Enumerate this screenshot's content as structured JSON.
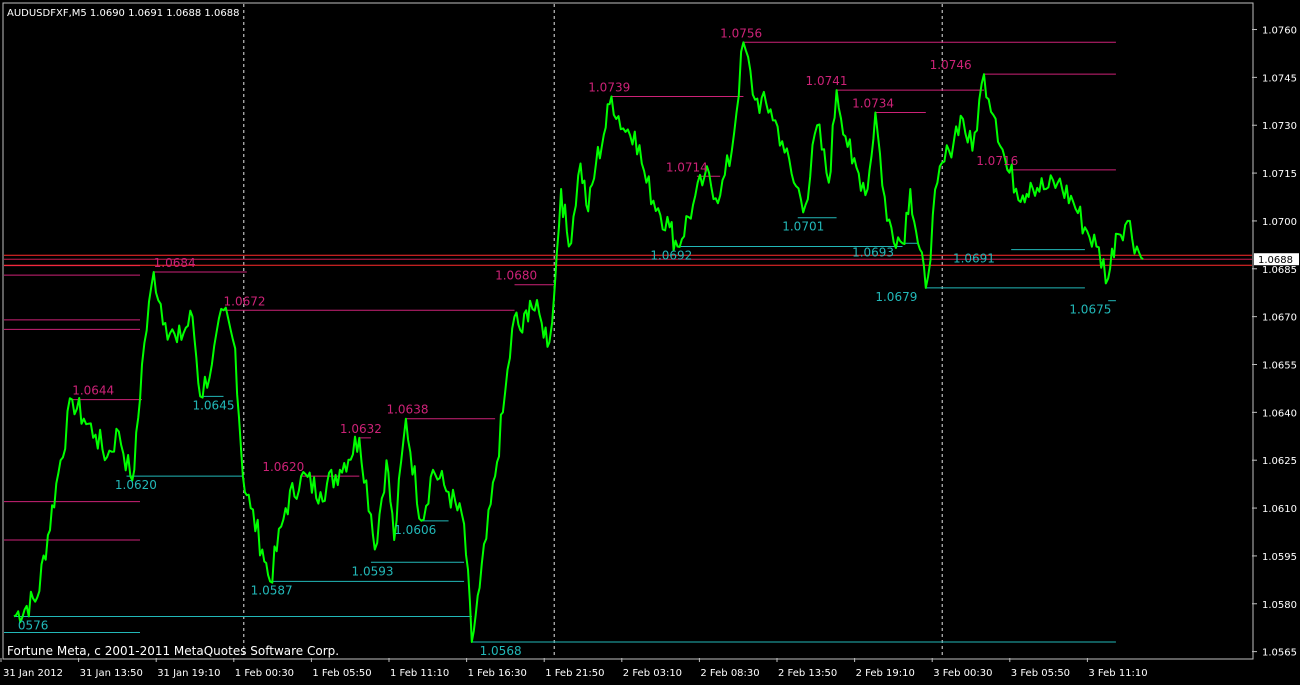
{
  "header": {
    "symbol_line": "AUDUSDFXF,M5  1.0690 1.0691 1.0688 1.0688"
  },
  "footer": {
    "copyright": "Fortune Meta, c 2001-2011 MetaQuotes Software Corp."
  },
  "colors": {
    "background": "#000000",
    "frame": "#c0c0c0",
    "price_line": "#00ff00",
    "resistance": "#cc2277",
    "support": "#22b8b8",
    "current_price_line": "#ff0000",
    "separator": "#ffffff"
  },
  "chart_data": {
    "type": "line",
    "symbol": "AUDUSDFXF",
    "timeframe": "M5",
    "ylim": [
      1.0563,
      1.0768
    ],
    "current_price": "1.0688",
    "y_ticks": [
      "1.0760",
      "1.0745",
      "1.0730",
      "1.0715",
      "1.0700",
      "1.0685",
      "1.0670",
      "1.0655",
      "1.0640",
      "1.0625",
      "1.0610",
      "1.0595",
      "1.0580",
      "1.0565"
    ],
    "x_ticks": [
      "31 Jan 2012",
      "31 Jan 13:50",
      "31 Jan 19:10",
      "1 Feb 00:30",
      "1 Feb 05:50",
      "1 Feb 11:10",
      "1 Feb 16:30",
      "1 Feb 21:50",
      "2 Feb 03:10",
      "2 Feb 08:30",
      "2 Feb 13:50",
      "2 Feb 19:10",
      "3 Feb 00:30",
      "3 Feb 05:50",
      "3 Feb 11:10"
    ],
    "day_separators_at_tick": [
      3,
      7,
      12
    ],
    "series": [
      {
        "values": [
          [
            0,
            1.0576
          ],
          [
            0.3,
            1.0582
          ],
          [
            0.6,
            1.0625
          ],
          [
            0.75,
            1.0644
          ],
          [
            0.9,
            1.0638
          ],
          [
            1.05,
            1.0633
          ],
          [
            1.2,
            1.0626
          ],
          [
            1.35,
            1.0634
          ],
          [
            1.5,
            1.062
          ],
          [
            1.55,
            1.0622
          ],
          [
            1.65,
            1.0655
          ],
          [
            1.8,
            1.0684
          ],
          [
            1.95,
            1.0668
          ],
          [
            2.1,
            1.0662
          ],
          [
            2.3,
            1.067
          ],
          [
            2.4,
            1.0645
          ],
          [
            2.55,
            1.0655
          ],
          [
            2.7,
            1.0672
          ],
          [
            2.85,
            1.066
          ],
          [
            2.95,
            1.062
          ],
          [
            3.05,
            1.061
          ],
          [
            3.2,
            1.0597
          ],
          [
            3.3,
            1.0587
          ],
          [
            3.5,
            1.061
          ],
          [
            3.7,
            1.062
          ],
          [
            3.95,
            1.0615
          ],
          [
            4.2,
            1.0622
          ],
          [
            4.45,
            1.0632
          ],
          [
            4.6,
            1.0608
          ],
          [
            4.65,
            1.0597
          ],
          [
            4.8,
            1.0625
          ],
          [
            4.9,
            1.06
          ],
          [
            5.05,
            1.0638
          ],
          [
            5.25,
            1.0606
          ],
          [
            5.4,
            1.0622
          ],
          [
            5.6,
            1.0615
          ],
          [
            5.8,
            1.0605
          ],
          [
            5.9,
            1.0568
          ],
          [
            6.0,
            1.0585
          ],
          [
            6.2,
            1.062
          ],
          [
            6.3,
            1.064
          ],
          [
            6.45,
            1.067
          ],
          [
            6.55,
            1.0665
          ],
          [
            6.65,
            1.0675
          ],
          [
            6.8,
            1.0668
          ],
          [
            6.9,
            1.0662
          ],
          [
            6.97,
            1.068
          ],
          [
            7.05,
            1.071
          ],
          [
            7.15,
            1.0692
          ],
          [
            7.3,
            1.0718
          ],
          [
            7.4,
            1.0703
          ],
          [
            7.5,
            1.0718
          ],
          [
            7.6,
            1.0727
          ],
          [
            7.7,
            1.0739
          ],
          [
            7.85,
            1.0729
          ],
          [
            8.0,
            1.0728
          ],
          [
            8.15,
            1.0712
          ],
          [
            8.3,
            1.0704
          ],
          [
            8.45,
            1.0698
          ],
          [
            8.55,
            1.0692
          ],
          [
            8.75,
            1.0705
          ],
          [
            8.9,
            1.0714
          ],
          [
            9.1,
            1.0708
          ],
          [
            9.25,
            1.0722
          ],
          [
            9.4,
            1.0756
          ],
          [
            9.55,
            1.0738
          ],
          [
            9.75,
            1.0735
          ],
          [
            9.9,
            1.0725
          ],
          [
            10.05,
            1.0712
          ],
          [
            10.2,
            1.0705
          ],
          [
            10.35,
            1.073
          ],
          [
            10.5,
            1.0712
          ],
          [
            10.6,
            1.0741
          ],
          [
            10.8,
            1.0718
          ],
          [
            11.0,
            1.071
          ],
          [
            11.1,
            1.0734
          ],
          [
            11.25,
            1.07
          ],
          [
            11.45,
            1.0693
          ],
          [
            11.55,
            1.071
          ],
          [
            11.65,
            1.0693
          ],
          [
            11.75,
            1.0679
          ],
          [
            11.9,
            1.0712
          ],
          [
            12.05,
            1.0722
          ],
          [
            12.2,
            1.0733
          ],
          [
            12.35,
            1.0722
          ],
          [
            12.5,
            1.0746
          ],
          [
            12.65,
            1.0732
          ],
          [
            12.8,
            1.0716
          ],
          [
            13.0,
            1.0708
          ],
          [
            13.1,
            1.0712
          ],
          [
            13.3,
            1.071
          ],
          [
            13.45,
            1.0712
          ],
          [
            13.65,
            1.0706
          ],
          [
            13.8,
            1.0698
          ],
          [
            13.95,
            1.0692
          ],
          [
            14.1,
            1.0682
          ],
          [
            14.2,
            1.0696
          ],
          [
            14.35,
            1.07
          ],
          [
            14.5,
            1.069
          ],
          [
            14.55,
            1.0688
          ]
        ]
      }
    ],
    "resistance_levels": [
      {
        "label": "1.0644",
        "x_from": 0.75,
        "x_to": 1.65
      },
      {
        "label": "1.0684",
        "x_from": 1.8,
        "x_to": 3.0
      },
      {
        "label": "1.0672",
        "x_from": 2.7,
        "x_to": 6.45
      },
      {
        "label": "1.0620",
        "x_from": 3.7,
        "x_to": 4.45
      },
      {
        "label": "1.0632",
        "x_from": 4.45,
        "x_to": 4.6
      },
      {
        "label": "1.0638",
        "x_from": 5.05,
        "x_to": 6.2
      },
      {
        "label": "1.0680",
        "x_from": 6.45,
        "x_to": 6.97
      },
      {
        "label": "1.0739",
        "x_from": 7.7,
        "x_to": 9.4
      },
      {
        "label": "1.0714",
        "x_from": 8.8,
        "x_to": 9.1
      },
      {
        "label": "1.0756",
        "x_from": 9.4,
        "x_to": 14.2
      },
      {
        "label": "1.0741",
        "x_from": 10.6,
        "x_to": 12.5
      },
      {
        "label": "1.0734",
        "x_from": 11.1,
        "x_to": 11.75
      },
      {
        "label": "1.0746",
        "x_from": 12.5,
        "x_to": 14.2
      },
      {
        "label": "1.0716",
        "x_from": 12.8,
        "x_to": 14.2
      }
    ],
    "resistance_labels_x": [
      0.75,
      1.8,
      2.7,
      3.2,
      4.2,
      4.8,
      6.2,
      7.4,
      8.4,
      9.1,
      10.2,
      10.8,
      11.8,
      12.4
    ],
    "support_levels": [
      {
        "label": "0576",
        "x_from": 0.0,
        "x_to": 5.9
      },
      {
        "label": "1.0620",
        "x_from": 1.45,
        "x_to": 2.95
      },
      {
        "label": "1.0645",
        "x_from": 2.4,
        "x_to": 2.7
      },
      {
        "label": "1.0587",
        "x_from": 3.3,
        "x_to": 5.8
      },
      {
        "label": "1.0593",
        "x_from": 4.6,
        "x_to": 5.8
      },
      {
        "label": "1.0606",
        "x_from": 5.25,
        "x_to": 5.6
      },
      {
        "label": "1.0568",
        "x_from": 5.9,
        "x_to": 14.2
      },
      {
        "label": "1.0692",
        "x_from": 8.55,
        "x_to": 11.45
      },
      {
        "label": "1.0701",
        "x_from": 10.1,
        "x_to": 10.6
      },
      {
        "label": "1.0693",
        "x_from": 11.45,
        "x_to": 11.65
      },
      {
        "label": "1.0679",
        "x_from": 11.75,
        "x_to": 13.8
      },
      {
        "label": "1.0691",
        "x_from": 12.85,
        "x_to": 13.8
      },
      {
        "label": "1.0675",
        "x_from": 14.1,
        "x_to": 14.2
      }
    ],
    "support_labels_x": [
      0.05,
      1.3,
      2.3,
      3.05,
      4.35,
      4.9,
      6.0,
      8.2,
      9.9,
      10.8,
      11.1,
      12.1,
      13.6
    ],
    "extra_left_lines": [
      {
        "kind": "resistance",
        "y": 1.0683
      },
      {
        "kind": "resistance",
        "y": 1.0669
      },
      {
        "kind": "resistance",
        "y": 1.0666
      },
      {
        "kind": "resistance",
        "y": 1.0686
      },
      {
        "kind": "support",
        "y": 1.0571
      },
      {
        "kind": "resistance",
        "y": 1.0612
      },
      {
        "kind": "resistance",
        "y": 1.06
      }
    ]
  }
}
